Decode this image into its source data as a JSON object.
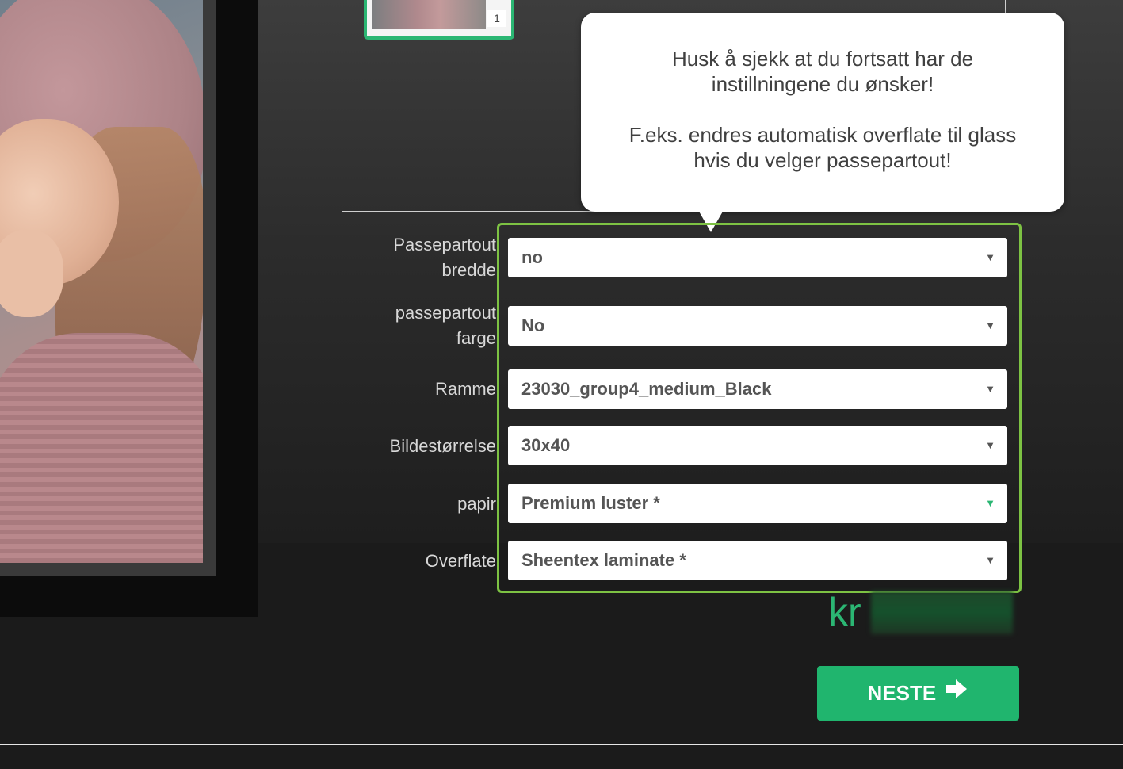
{
  "thumbnail": {
    "number": "1"
  },
  "tooltip": {
    "line1": "Husk å sjekk at du fortsatt har de",
    "line2": "instillningene du ønsker!",
    "line3": "F.eks. endres automatisk overflate til glass",
    "line4": "hvis du velger passepartout!"
  },
  "options": [
    {
      "label_1": "Passepartout",
      "label_2": "bredde",
      "value": "no"
    },
    {
      "label_1": "passepartout",
      "label_2": "farge",
      "value": "No"
    },
    {
      "label": "Ramme",
      "value": "23030_group4_medium_Black"
    },
    {
      "label": "Bildestørrelse",
      "value": "30x40"
    },
    {
      "label": "papir",
      "value": "Premium luster *"
    },
    {
      "label": "Overflate",
      "value": "Sheentex laminate *"
    }
  ],
  "price": {
    "currency": "kr"
  },
  "next_button": {
    "label": "NESTE"
  },
  "colors": {
    "accent_green": "#20b56e",
    "highlight_border": "#7dc243"
  },
  "icons": {
    "caret": "caret-down-icon",
    "next_arrow": "arrow-right-icon"
  }
}
